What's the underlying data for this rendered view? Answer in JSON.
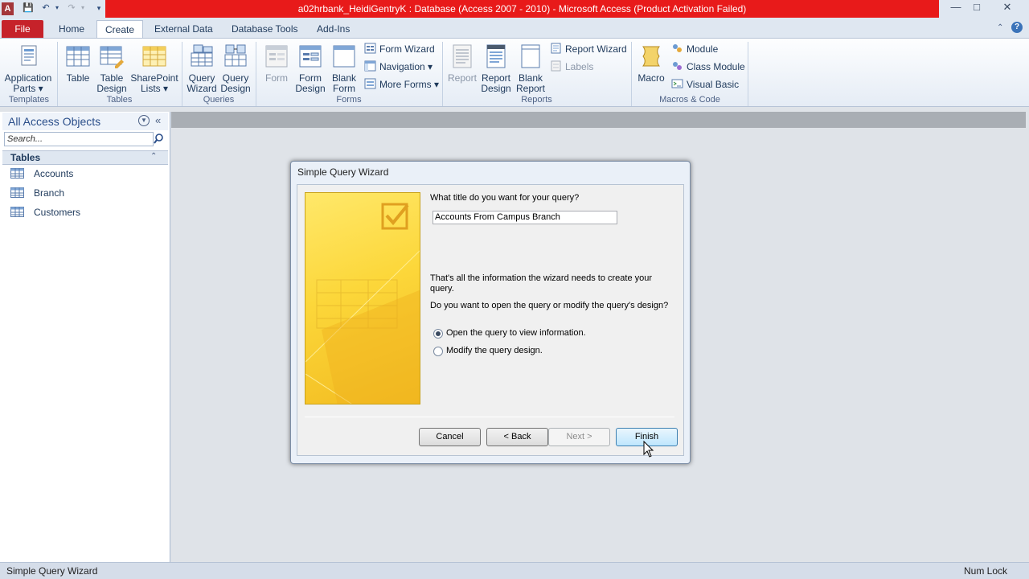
{
  "window": {
    "title": "a02hrbank_HeidiGentryK : Database (Access 2007 - 2010)  -  Microsoft Access (Product Activation Failed)",
    "app_icon_letter": "A"
  },
  "tabs": [
    "File",
    "Home",
    "Create",
    "External Data",
    "Database Tools",
    "Add-Ins"
  ],
  "ribbon": {
    "groups": {
      "templates": "Templates",
      "tables": "Tables",
      "queries": "Queries",
      "forms": "Forms",
      "reports": "Reports",
      "macros": "Macros & Code"
    },
    "buttons": {
      "application_parts_1": "Application",
      "application_parts_2": "Parts ▾",
      "table": "Table",
      "table_design_1": "Table",
      "table_design_2": "Design",
      "sharepoint_1": "SharePoint",
      "sharepoint_2": "Lists ▾",
      "query_wizard_1": "Query",
      "query_wizard_2": "Wizard",
      "query_design_1": "Query",
      "query_design_2": "Design",
      "form": "Form",
      "form_design_1": "Form",
      "form_design_2": "Design",
      "blank_form_1": "Blank",
      "blank_form_2": "Form",
      "form_wizard": "Form Wizard",
      "navigation": "Navigation ▾",
      "more_forms": "More Forms ▾",
      "report": "Report",
      "report_design_1": "Report",
      "report_design_2": "Design",
      "blank_report_1": "Blank",
      "blank_report_2": "Report",
      "report_wizard": "Report Wizard",
      "labels": "Labels",
      "macro": "Macro",
      "module": "Module",
      "class_module": "Class Module",
      "visual_basic": "Visual Basic"
    }
  },
  "nav": {
    "header": "All Access Objects",
    "search_placeholder": "Search...",
    "group": "Tables",
    "items": [
      "Accounts",
      "Branch",
      "Customers"
    ]
  },
  "dialog": {
    "title": "Simple Query Wizard",
    "question": "What title do you want for your query?",
    "title_value": "Accounts From Campus Branch",
    "info_line1": "That's all the information the wizard needs to create your",
    "info_line2": "query.",
    "prompt": "Do you want to open the query or modify the query's design?",
    "option_open": "Open the query to view information.",
    "option_modify": "Modify the query design.",
    "selected_option": "open",
    "buttons": {
      "cancel": "Cancel",
      "back": "< Back",
      "next": "Next >",
      "finish": "Finish"
    }
  },
  "status": {
    "left": "Simple Query Wizard",
    "right": "Num Lock"
  }
}
